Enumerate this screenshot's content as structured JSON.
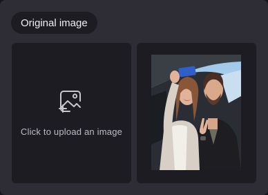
{
  "section": {
    "title": "Original image"
  },
  "upload": {
    "label": "Click to upload an image",
    "icon": "add-image-icon"
  },
  "preview": {
    "alt": "Preview photo of a smiling couple taking a selfie in front of a car"
  },
  "colors": {
    "panel": "#2e2d36",
    "box": "#1d1c23",
    "text": "#f0eff4",
    "muted_text": "#bdbcc6"
  }
}
